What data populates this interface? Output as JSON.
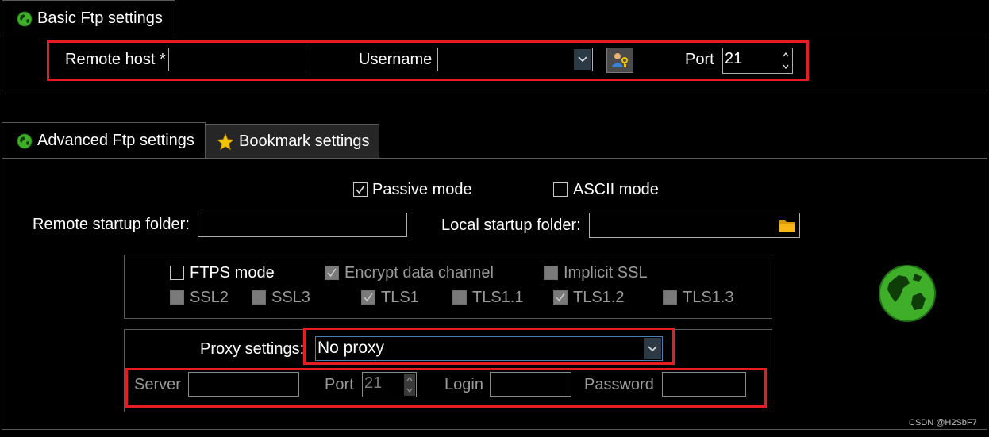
{
  "basic_tab": {
    "label": "Basic Ftp settings"
  },
  "basic": {
    "remote_host_label": "Remote host *",
    "remote_host_value": "",
    "username_label": "Username",
    "username_value": "",
    "port_label": "Port",
    "port_value": "21"
  },
  "advanced_tabs": [
    {
      "label": "Advanced Ftp settings",
      "active": true
    },
    {
      "label": "Bookmark settings",
      "active": false
    }
  ],
  "advanced": {
    "passive_mode_label": "Passive mode",
    "passive_mode_checked": true,
    "ascii_mode_label": "ASCII mode",
    "ascii_mode_checked": false,
    "remote_startup_label": "Remote startup folder:",
    "remote_startup_value": "",
    "local_startup_label": "Local startup folder:",
    "local_startup_value": ""
  },
  "ftps": {
    "ftps_mode_label": "FTPS mode",
    "encrypt_label": "Encrypt data channel",
    "implicit_label": "Implicit SSL",
    "ssl2_label": "SSL2",
    "ssl3_label": "SSL3",
    "tls1_label": "TLS1",
    "tls11_label": "TLS1.1",
    "tls12_label": "TLS1.2",
    "tls13_label": "TLS1.3"
  },
  "proxy": {
    "label": "Proxy settings:",
    "selected": "No proxy",
    "server_label": "Server",
    "server_value": "",
    "port_label": "Port",
    "port_value": "21",
    "login_label": "Login",
    "login_value": "",
    "password_label": "Password",
    "password_value": ""
  },
  "watermark": "CSDN @H2SbF7",
  "colors": {
    "background": "#000000",
    "highlight_border": "#e81c24",
    "globe_green": "#3fae29",
    "star_yellow": "#f5c400",
    "folder_yellow": "#f7b516"
  }
}
